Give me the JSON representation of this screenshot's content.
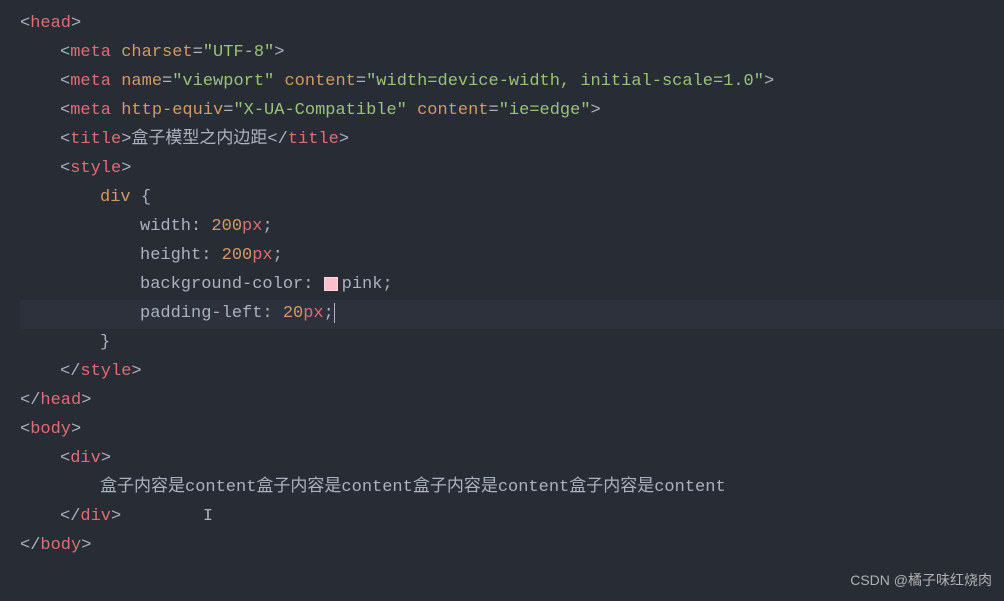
{
  "code": {
    "tags": {
      "head": "head",
      "meta": "meta",
      "title": "title",
      "style": "style",
      "body": "body",
      "div": "div"
    },
    "attrs": {
      "charset": "charset",
      "name": "name",
      "content": "content",
      "httpEquiv": "http-equiv"
    },
    "values": {
      "utf8": "\"UTF-8\"",
      "viewport": "\"viewport\"",
      "viewportContent": "\"width=device-width, initial-scale=1.0\"",
      "xua": "\"X-UA-Compatible\"",
      "ieedge": "\"ie=edge\""
    },
    "titleText": "盒子模型之内边距",
    "css": {
      "selector": "div",
      "props": {
        "width": "width",
        "height": "height",
        "bgcolor": "background-color",
        "paddingLeft": "padding-left"
      },
      "vals": {
        "width": "200",
        "widthUnit": "px",
        "height": "200",
        "heightUnit": "px",
        "bgcolor": "pink",
        "paddingLeft": "20",
        "paddingLeftUnit": "px"
      }
    },
    "divContent": "盒子内容是content盒子内容是content盒子内容是content盒子内容是content"
  },
  "watermark": "CSDN @橘子味红烧肉",
  "colors": {
    "swatch": "#ffc0cb",
    "background": "#282c34"
  }
}
